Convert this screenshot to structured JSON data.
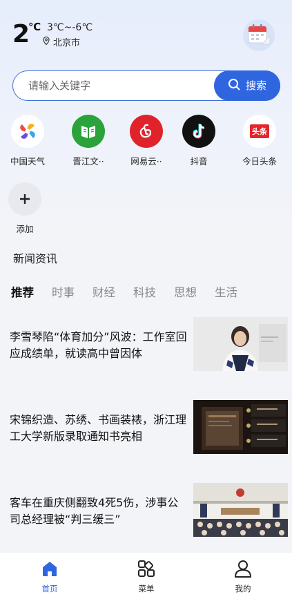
{
  "weather": {
    "temperature": "2",
    "unit": "℃",
    "range": "3℃~-6℃",
    "city": "北京市"
  },
  "search": {
    "placeholder": "请输入关键字",
    "button_label": "搜索"
  },
  "shortcuts": [
    {
      "label": "中国天气",
      "icon": "pinwheel-icon"
    },
    {
      "label": "晋江文··",
      "icon": "jinjiang-book-icon"
    },
    {
      "label": "网易云··",
      "icon": "netease-music-icon"
    },
    {
      "label": "抖音",
      "icon": "tiktok-icon"
    },
    {
      "label": "今日头条",
      "icon": "toutiao-icon",
      "icon_text": "头条"
    },
    {
      "label": "添加",
      "icon": "plus-icon"
    }
  ],
  "news": {
    "section_title": "新闻资讯",
    "tabs": [
      "推荐",
      "时事",
      "财经",
      "科技",
      "思想",
      "生活"
    ],
    "active_tab": "推荐",
    "items": [
      {
        "title": "李雪琴陷“体育加分”风波：工作室回应成绩单，就读高中曾因体"
      },
      {
        "title": "宋锦织造、苏绣、书画装裱，浙江理工大学新版录取通知书亮相"
      },
      {
        "title": "客车在重庆侧翻致4死5伤，涉事公司总经理被“判三缓三”"
      }
    ]
  },
  "bottom_nav": {
    "items": [
      {
        "label": "首页",
        "icon": "home-icon",
        "active": true
      },
      {
        "label": "菜单",
        "icon": "grid-menu-icon",
        "active": false
      },
      {
        "label": "我的",
        "icon": "user-icon",
        "active": false
      }
    ]
  },
  "colors": {
    "accent": "#2f66e0",
    "background": "#f3f4f8",
    "tiktok": "#111111",
    "netease": "#e0232b",
    "toutiao": "#e5252a",
    "jinjiang": "#2aa33a"
  }
}
